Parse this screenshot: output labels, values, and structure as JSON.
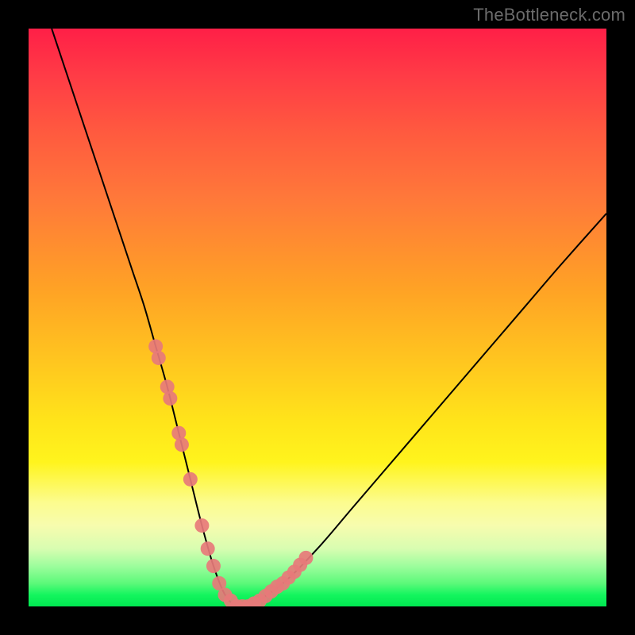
{
  "watermark": "TheBottleneck.com",
  "chart_data": {
    "type": "line",
    "title": "",
    "xlabel": "",
    "ylabel": "",
    "xlim": [
      0,
      100
    ],
    "ylim": [
      0,
      100
    ],
    "series": [
      {
        "name": "bottleneck-curve",
        "x": [
          4,
          6,
          8,
          10,
          12,
          14,
          16,
          18,
          20,
          22,
          24,
          26,
          28,
          30,
          32,
          34,
          36,
          38,
          44,
          50,
          56,
          62,
          68,
          74,
          80,
          86,
          92,
          100
        ],
        "values": [
          100,
          94,
          88,
          82,
          76,
          70,
          64,
          58,
          52,
          45,
          38,
          30,
          22,
          14,
          7,
          2,
          0,
          0,
          4,
          10,
          17,
          24,
          31,
          38,
          45,
          52,
          59,
          68
        ]
      }
    ],
    "markers": {
      "name": "highlighted-points",
      "color": "#e77a79",
      "radius_px": 9,
      "x": [
        22,
        22.5,
        24,
        24.5,
        26,
        26.5,
        28,
        30,
        31,
        32,
        33,
        34,
        35,
        36,
        37,
        38,
        39,
        40,
        41,
        42,
        43,
        44,
        45,
        46,
        47,
        48
      ],
      "values": [
        45,
        43,
        38,
        36,
        30,
        28,
        22,
        14,
        10,
        7,
        4,
        2,
        1,
        0,
        0,
        0,
        0.5,
        1,
        1.8,
        2.6,
        3.4,
        4,
        5,
        6,
        7.2,
        8.4
      ]
    },
    "legend": [],
    "grid": false
  }
}
